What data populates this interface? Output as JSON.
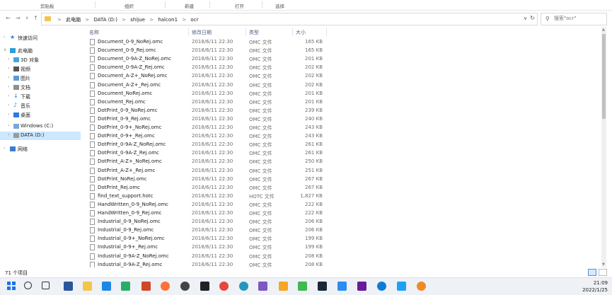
{
  "ribbon": {
    "items": [
      "剪贴板",
      "组织",
      "新建",
      "打开",
      "选择"
    ]
  },
  "address": {
    "crumbs": [
      "此电脑",
      "DATA (D:)",
      "shijue",
      "halcon1",
      "ocr"
    ]
  },
  "search": {
    "placeholder": "搜索\"ocr\""
  },
  "nav": {
    "items": [
      {
        "label": "快速访问",
        "icon": "star-icon"
      },
      {
        "label": "此电脑",
        "icon": "computer-icon"
      },
      {
        "label": "3D 对象",
        "icon": "cube-icon"
      },
      {
        "label": "视频",
        "icon": "video-icon"
      },
      {
        "label": "图片",
        "icon": "pictures-icon"
      },
      {
        "label": "文档",
        "icon": "documents-icon"
      },
      {
        "label": "下载",
        "icon": "download-icon"
      },
      {
        "label": "音乐",
        "icon": "music-icon"
      },
      {
        "label": "桌面",
        "icon": "desktop-icon"
      },
      {
        "label": "Windows (C:)",
        "icon": "drive-icon"
      },
      {
        "label": "DATA (D:)",
        "icon": "drive-icon"
      },
      {
        "label": "网络",
        "icon": "network-icon"
      }
    ]
  },
  "columns": {
    "name": "名称",
    "date": "修改日期",
    "type": "类型",
    "size": "大小"
  },
  "files": [
    {
      "name": "Document_0-9_NoRej.omc",
      "date": "2018/6/11 22:30",
      "type": "OMC 文件",
      "size": "165 KB"
    },
    {
      "name": "Document_0-9_Rej.omc",
      "date": "2018/6/11 22:30",
      "type": "OMC 文件",
      "size": "165 KB"
    },
    {
      "name": "Document_0-9A-Z_NoRej.omc",
      "date": "2018/6/11 22:30",
      "type": "OMC 文件",
      "size": "201 KB"
    },
    {
      "name": "Document_0-9A-Z_Rej.omc",
      "date": "2018/6/11 22:30",
      "type": "OMC 文件",
      "size": "202 KB"
    },
    {
      "name": "Document_A-Z+_NoRej.omc",
      "date": "2018/6/11 22:30",
      "type": "OMC 文件",
      "size": "202 KB"
    },
    {
      "name": "Document_A-Z+_Rej.omc",
      "date": "2018/6/11 22:30",
      "type": "OMC 文件",
      "size": "202 KB"
    },
    {
      "name": "Document_NoRej.omc",
      "date": "2018/6/11 22:30",
      "type": "OMC 文件",
      "size": "201 KB"
    },
    {
      "name": "Document_Rej.omc",
      "date": "2018/6/11 22:30",
      "type": "OMC 文件",
      "size": "201 KB"
    },
    {
      "name": "DotPrint_0-9_NoRej.omc",
      "date": "2018/6/11 22:30",
      "type": "OMC 文件",
      "size": "239 KB"
    },
    {
      "name": "DotPrint_0-9_Rej.omc",
      "date": "2018/6/11 22:30",
      "type": "OMC 文件",
      "size": "240 KB"
    },
    {
      "name": "DotPrint_0-9+_NoRej.omc",
      "date": "2018/6/11 22:30",
      "type": "OMC 文件",
      "size": "243 KB"
    },
    {
      "name": "DotPrint_0-9+_Rej.omc",
      "date": "2018/6/11 22:30",
      "type": "OMC 文件",
      "size": "243 KB"
    },
    {
      "name": "DotPrint_0-9A-Z_NoRej.omc",
      "date": "2018/6/11 22:30",
      "type": "OMC 文件",
      "size": "261 KB"
    },
    {
      "name": "DotPrint_0-9A-Z_Rej.omc",
      "date": "2018/6/11 22:30",
      "type": "OMC 文件",
      "size": "261 KB"
    },
    {
      "name": "DotPrint_A-Z+_NoRej.omc",
      "date": "2018/6/11 22:30",
      "type": "OMC 文件",
      "size": "250 KB"
    },
    {
      "name": "DotPrint_A-Z+_Rej.omc",
      "date": "2018/6/11 22:30",
      "type": "OMC 文件",
      "size": "251 KB"
    },
    {
      "name": "DotPrint_NoRej.omc",
      "date": "2018/6/11 22:30",
      "type": "OMC 文件",
      "size": "267 KB"
    },
    {
      "name": "DotPrint_Rej.omc",
      "date": "2018/6/11 22:30",
      "type": "OMC 文件",
      "size": "267 KB"
    },
    {
      "name": "find_text_support.hotc",
      "date": "2018/6/11 22:30",
      "type": "HOTC 文件",
      "size": "1,827 KB"
    },
    {
      "name": "HandWritten_0-9_NoRej.omc",
      "date": "2018/6/11 22:30",
      "type": "OMC 文件",
      "size": "222 KB"
    },
    {
      "name": "HandWritten_0-9_Rej.omc",
      "date": "2018/6/11 22:30",
      "type": "OMC 文件",
      "size": "222 KB"
    },
    {
      "name": "Industrial_0-9_NoRej.omc",
      "date": "2018/6/11 22:30",
      "type": "OMC 文件",
      "size": "206 KB"
    },
    {
      "name": "Industrial_0-9_Rej.omc",
      "date": "2018/6/11 22:30",
      "type": "OMC 文件",
      "size": "206 KB"
    },
    {
      "name": "Industrial_0-9+_NoRej.omc",
      "date": "2018/6/11 22:30",
      "type": "OMC 文件",
      "size": "199 KB"
    },
    {
      "name": "Industrial_0-9+_Rej.omc",
      "date": "2018/6/11 22:30",
      "type": "OMC 文件",
      "size": "199 KB"
    },
    {
      "name": "Industrial_0-9A-Z_NoRej.omc",
      "date": "2018/6/11 22:30",
      "type": "OMC 文件",
      "size": "208 KB"
    },
    {
      "name": "Industrial_0-9A-Z_Rej.omc",
      "date": "2018/6/11 22:30",
      "type": "OMC 文件",
      "size": "208 KB"
    }
  ],
  "status": {
    "count": "71 个项目"
  },
  "taskbar": {
    "apps": [
      {
        "name": "search-icon",
        "color": "#333333"
      },
      {
        "name": "task-view-icon",
        "color": "#333333"
      },
      {
        "name": "word-icon",
        "color": "#2b579a"
      },
      {
        "name": "file-explorer-icon",
        "color": "#f3c54c"
      },
      {
        "name": "app-icon-k",
        "color": "#1e88e5"
      },
      {
        "name": "wechat-icon",
        "color": "#2aae67"
      },
      {
        "name": "powerpoint-icon",
        "color": "#d24726"
      },
      {
        "name": "firefox-icon",
        "color": "#ff7139"
      },
      {
        "name": "obs-icon",
        "color": "#444444"
      },
      {
        "name": "app-icon-dark",
        "color": "#222222"
      },
      {
        "name": "chrome-icon",
        "color": "#e8453c"
      },
      {
        "name": "edge-icon",
        "color": "#2596be"
      },
      {
        "name": "visual-studio-icon",
        "color": "#7e57c2"
      },
      {
        "name": "app-icon-amber",
        "color": "#f5a623"
      },
      {
        "name": "app-icon-green",
        "color": "#3fb950"
      },
      {
        "name": "steam-icon",
        "color": "#1b2838"
      },
      {
        "name": "app-icon-blue",
        "color": "#2d8cf0"
      },
      {
        "name": "vs-code-icon",
        "color": "#6a1b9a"
      },
      {
        "name": "edge-icon-2",
        "color": "#0f7bd7"
      },
      {
        "name": "app-icon-sky",
        "color": "#1da1f2"
      },
      {
        "name": "app-icon-orange",
        "color": "#f08a24"
      }
    ],
    "time": "21:09",
    "date": "2022/1/25"
  }
}
